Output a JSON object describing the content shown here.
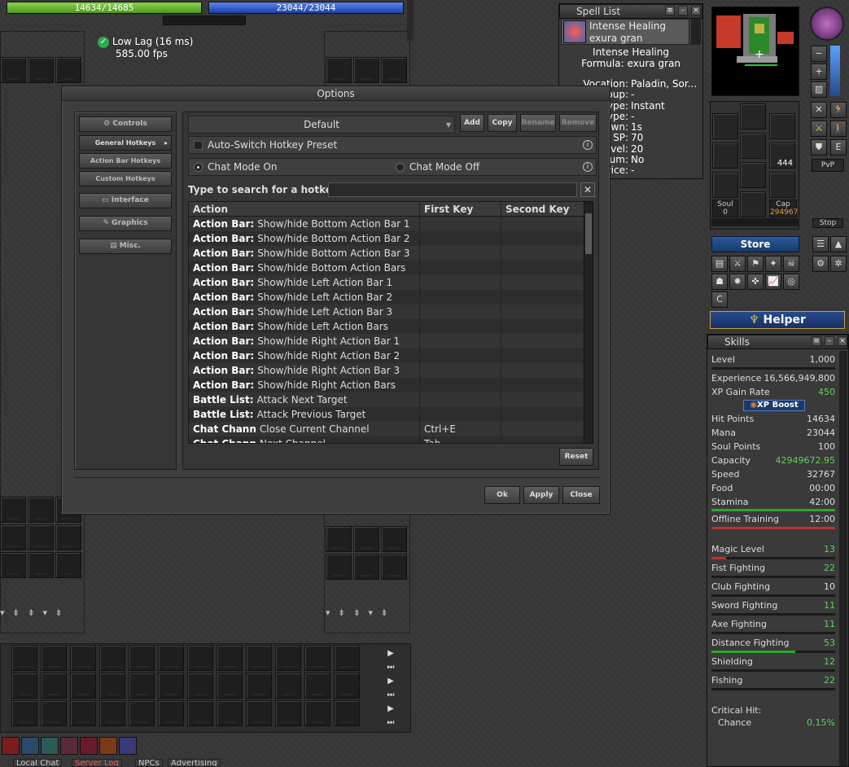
{
  "top": {
    "health_text": "14634/14685",
    "mana_text": "23044/23044",
    "health_fraction": 0.997,
    "mana_fraction": 1.0
  },
  "status": {
    "lag": "Low Lag (16 ms)",
    "fps": "585.00 fps"
  },
  "spell_list": {
    "title": "Spell List",
    "selected_name": "Intense Healing",
    "selected_words": "exura gran",
    "detail_name": "Intense Healing",
    "formula": "Formula: exura gran",
    "fields": [
      {
        "label": "Vocation:",
        "value": "Paladin, Sor..."
      },
      {
        "label": "oup:",
        "value": "-"
      },
      {
        "label": "ype:",
        "value": "Instant"
      },
      {
        "label": "ype:",
        "value": "-"
      },
      {
        "label": "wn:",
        "value": "1s"
      },
      {
        "label": "SP:",
        "value": "70"
      },
      {
        "label": "vel:",
        "value": "20"
      },
      {
        "label": "um:",
        "value": "No"
      },
      {
        "label": "rice:",
        "value": "-"
      }
    ]
  },
  "options": {
    "title": "Options",
    "sidebar": {
      "controls": "Controls",
      "general_hotkeys": "General Hotkeys",
      "action_bar_hotkeys": "Action Bar Hotkeys",
      "custom_hotkeys": "Custom Hotkeys",
      "interface": "Interface",
      "graphics": "Graphics",
      "misc": "Misc."
    },
    "preset": "Default",
    "buttons": {
      "add": "Add",
      "copy": "Copy",
      "rename": "Rename",
      "remove": "Remove",
      "reset": "Reset",
      "ok": "Ok",
      "apply": "Apply",
      "close": "Close"
    },
    "auto_switch": "Auto-Switch Hotkey Preset",
    "chat_on": "Chat Mode On",
    "chat_off": "Chat Mode Off",
    "search_label": "Type to search for a hotkey:",
    "search_value": "",
    "columns": {
      "action": "Action",
      "first": "First Key",
      "second": "Second Key"
    },
    "rows": [
      {
        "cat": "Action Bar:",
        "act": "Show/hide Bottom Action Bar 1",
        "k1": "",
        "k2": ""
      },
      {
        "cat": "Action Bar:",
        "act": "Show/hide Bottom Action Bar 2",
        "k1": "",
        "k2": ""
      },
      {
        "cat": "Action Bar:",
        "act": "Show/hide Bottom Action Bar 3",
        "k1": "",
        "k2": ""
      },
      {
        "cat": "Action Bar:",
        "act": "Show/hide Bottom Action Bars",
        "k1": "",
        "k2": ""
      },
      {
        "cat": "Action Bar:",
        "act": "Show/hide Left Action Bar 1",
        "k1": "",
        "k2": ""
      },
      {
        "cat": "Action Bar:",
        "act": "Show/hide Left Action Bar 2",
        "k1": "",
        "k2": ""
      },
      {
        "cat": "Action Bar:",
        "act": "Show/hide Left Action Bar 3",
        "k1": "",
        "k2": ""
      },
      {
        "cat": "Action Bar:",
        "act": "Show/hide Left Action Bars",
        "k1": "",
        "k2": ""
      },
      {
        "cat": "Action Bar:",
        "act": "Show/hide Right Action Bar 1",
        "k1": "",
        "k2": ""
      },
      {
        "cat": "Action Bar:",
        "act": "Show/hide Right Action Bar 2",
        "k1": "",
        "k2": ""
      },
      {
        "cat": "Action Bar:",
        "act": "Show/hide Right Action Bar 3",
        "k1": "",
        "k2": ""
      },
      {
        "cat": "Action Bar:",
        "act": "Show/hide Right Action Bars",
        "k1": "",
        "k2": ""
      },
      {
        "cat": "Battle List:",
        "act": "Attack Next Target",
        "k1": "",
        "k2": ""
      },
      {
        "cat": "Battle List:",
        "act": "Attack Previous Target",
        "k1": "",
        "k2": ""
      },
      {
        "cat": "Chat Chann",
        "act": "Close Current Channel",
        "k1": "Ctrl+E",
        "k2": ""
      },
      {
        "cat": "Chat Chann",
        "act": "Next Channel",
        "k1": "Tab",
        "k2": ""
      }
    ]
  },
  "inventory": {
    "soul_label": "Soul",
    "soul_value": "0",
    "cap_label": "Cap",
    "cap_value": "294967",
    "ammo_count": "444",
    "stop": "Stop",
    "pvp": "PvP"
  },
  "store": "Store",
  "helper": "Helper",
  "skills": {
    "title": "Skills",
    "rows": [
      {
        "label": "Level",
        "value": "1,000"
      },
      {
        "label": "Experience",
        "value": "16,566,949,800"
      },
      {
        "label": "XP Gain Rate",
        "value": "450"
      }
    ],
    "xp_boost": "XP Boost",
    "stats": [
      {
        "label": "Hit Points",
        "value": "14634"
      },
      {
        "label": "Mana",
        "value": "23044"
      },
      {
        "label": "Soul Points",
        "value": "100"
      },
      {
        "label": "Capacity",
        "value": "42949672.95"
      },
      {
        "label": "Speed",
        "value": "32767"
      },
      {
        "label": "Food",
        "value": "00:00"
      },
      {
        "label": "Stamina",
        "value": "42:00"
      }
    ],
    "offline": {
      "label": "Offline Training",
      "value": "12:00"
    },
    "combat": [
      {
        "label": "Magic Level",
        "value": "13",
        "color": "#5fd05f",
        "fill": 0.12
      },
      {
        "label": "Fist Fighting",
        "value": "22",
        "color": "#5fd05f",
        "fill": 0
      },
      {
        "label": "Club Fighting",
        "value": "10",
        "color": "#dddddd",
        "fill": 0
      },
      {
        "label": "Sword Fighting",
        "value": "11",
        "color": "#5fd05f",
        "fill": 0
      },
      {
        "label": "Axe Fighting",
        "value": "11",
        "color": "#5fd05f",
        "fill": 0
      },
      {
        "label": "Distance Fighting",
        "value": "53",
        "color": "#5fd05f",
        "fill": 0.68
      },
      {
        "label": "Shielding",
        "value": "12",
        "color": "#5fd05f",
        "fill": 0
      },
      {
        "label": "Fishing",
        "value": "22",
        "color": "#5fd05f",
        "fill": 0
      }
    ],
    "critical": "Critical Hit:",
    "chance": "Chance",
    "chance_value": "0.15%"
  },
  "chat_tabs": [
    "Local Chat",
    "Server Log",
    "NPCs",
    "Advertising"
  ],
  "colors": {
    "health": "#4d9a1d",
    "mana": "#1d40a8",
    "green_value": "#5fd05f"
  }
}
